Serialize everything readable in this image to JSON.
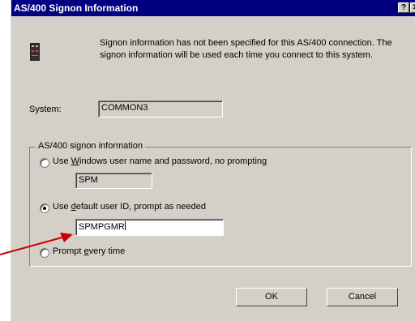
{
  "dialog": {
    "title": "AS/400 Signon Information",
    "help_button": "?",
    "close_button": "✕",
    "message": "Signon information has not been specified for this AS/400 connection.  The signon information will be used each time you connect to this system."
  },
  "system": {
    "label": "System:",
    "value": "COMMON3"
  },
  "signon_group": {
    "legend": "AS/400 signon information",
    "options": [
      {
        "pre": "Use ",
        "accel": "W",
        "post": "indows user name and password, no prompting",
        "selected": false,
        "field_value": "SPM"
      },
      {
        "pre": "Use ",
        "accel": "d",
        "post": "efault user ID, prompt as needed",
        "selected": true,
        "field_value": "SPMPGMR"
      },
      {
        "pre": "Prompt ",
        "accel": "e",
        "post": "very time",
        "selected": false
      }
    ]
  },
  "buttons": {
    "ok": "OK",
    "cancel": "Cancel"
  },
  "annotation": {
    "arrow_color": "#cc0000"
  },
  "colors": {
    "titlebar": "#000080",
    "face": "#d4d0c8"
  }
}
